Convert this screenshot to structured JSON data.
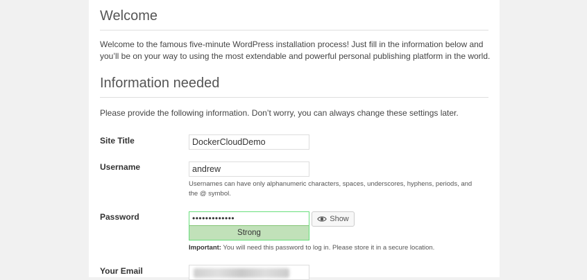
{
  "welcome": {
    "heading": "Welcome",
    "text": "Welcome to the famous five-minute WordPress installation process! Just fill in the information below and you’ll be on your way to using the most extendable and powerful personal publishing platform in the world."
  },
  "info": {
    "heading": "Information needed",
    "text": "Please provide the following information. Don’t worry, you can always change these settings later."
  },
  "form": {
    "site_title": {
      "label": "Site Title",
      "value": "DockerCloudDemo"
    },
    "username": {
      "label": "Username",
      "value": "andrew",
      "hint": "Usernames can have only alphanumeric characters, spaces, underscores, hyphens, periods, and the @ symbol."
    },
    "password": {
      "label": "Password",
      "masked_value": "•••••••••••••",
      "strength": "Strong",
      "show_label": "Show",
      "note_strong": "Important:",
      "note_rest": " You will need this password to log in. Please store it in a secure location."
    },
    "email": {
      "label": "Your Email"
    }
  },
  "colors": {
    "strength_bg": "#c1e1b9",
    "strength_border": "#68de7c",
    "page_bg": "#f1f1f1"
  },
  "icons": {
    "show": "eye-icon"
  }
}
